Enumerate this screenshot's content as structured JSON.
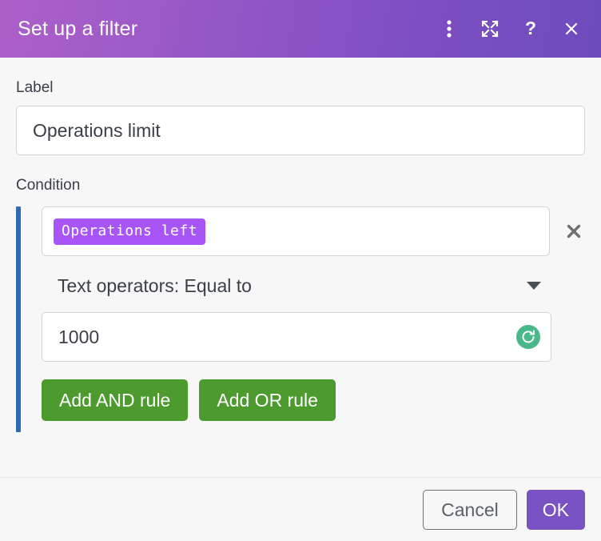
{
  "titlebar": {
    "title": "Set up a filter",
    "icons": [
      {
        "name": "more-options-icon",
        "glyph": "kebab"
      },
      {
        "name": "maximize-icon",
        "glyph": "expand"
      },
      {
        "name": "help-icon",
        "glyph": "question"
      },
      {
        "name": "close-icon",
        "glyph": "close"
      }
    ],
    "gradient_from": "#ad5fc9",
    "gradient_to": "#6e4cbd"
  },
  "form": {
    "label_caption": "Label",
    "label_value": "Operations limit",
    "label_placeholder": "",
    "condition_caption": "Condition"
  },
  "condition": {
    "group_bar_color": "#2d6cb2",
    "field_chip": "Operations left",
    "chip_color": "#a855f7",
    "remove_rule_icon": "close-icon",
    "operator_text": "Text operators: Equal to",
    "operator_caret_icon": "chevron-down-icon",
    "value": "1000",
    "value_placeholder": "",
    "value_reset_icon": "refresh-icon",
    "value_reset_color": "#49b98a",
    "add_and_label": "Add AND rule",
    "add_or_label": "Add OR rule",
    "add_button_color": "#4d9b2f"
  },
  "footer": {
    "cancel_label": "Cancel",
    "ok_label": "OK",
    "ok_color": "#7b52c4"
  }
}
